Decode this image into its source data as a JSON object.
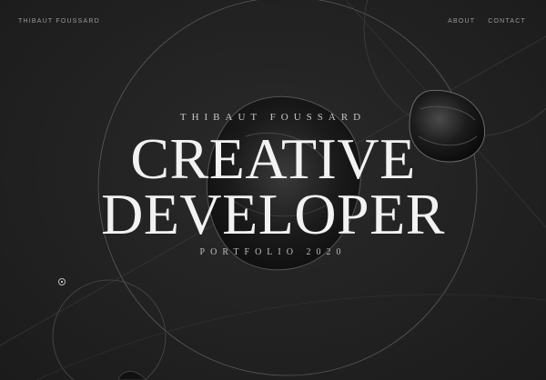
{
  "nav": {
    "brand": "THIBAUT FOUSSARD",
    "links": [
      "ABOUT",
      "CONTACT"
    ]
  },
  "hero": {
    "eyebrow": "THIBAUT FOUSSARD",
    "title_line1": "CREATIVE",
    "title_line2": "DEVELOPER",
    "subtitle": "PORTFOLIO 2020"
  },
  "colors": {
    "background": "#1e1e1e",
    "text": "#f2f2f2",
    "muted": "#9a9a9a"
  }
}
